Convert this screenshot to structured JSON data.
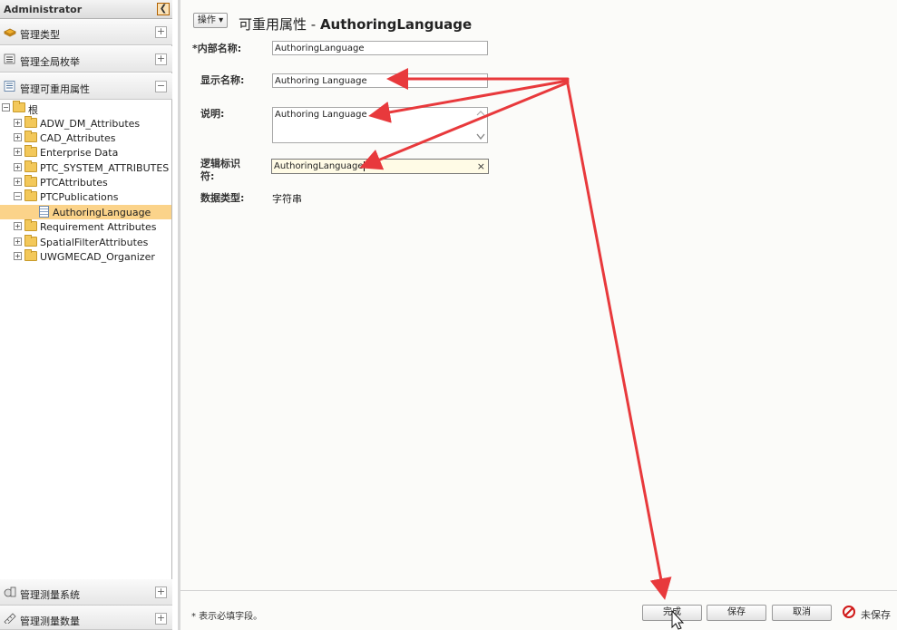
{
  "navigator": {
    "header": "Administrator",
    "collapse_glyph": "❮",
    "sections": [
      {
        "label": "管理类型",
        "icon": "types-icon",
        "toggle": "+"
      },
      {
        "label": "管理全局枚举",
        "icon": "enum-icon",
        "toggle": "+"
      },
      {
        "label": "管理可重用属性",
        "icon": "attributes-icon",
        "toggle": "−"
      }
    ],
    "bottom_sections": [
      {
        "label": "管理测量系统",
        "icon": "measurement-system-icon",
        "toggle": "+"
      },
      {
        "label": "管理测量数量",
        "icon": "measurement-quantity-icon",
        "toggle": "+"
      }
    ]
  },
  "tree": {
    "root": {
      "label": "根",
      "toggle": "−"
    },
    "items": [
      {
        "label": "ADW_DM_Attributes",
        "toggle": "+"
      },
      {
        "label": "CAD_Attributes",
        "toggle": "+"
      },
      {
        "label": "Enterprise Data",
        "toggle": "+"
      },
      {
        "label": "PTC_SYSTEM_ATTRIBUTES",
        "toggle": "+"
      },
      {
        "label": "PTCAttributes",
        "toggle": "+"
      },
      {
        "label": "PTCPublications",
        "toggle": "−"
      },
      {
        "label": "AuthoringLanguage",
        "selected": true
      },
      {
        "label": "Requirement Attributes",
        "toggle": "+"
      },
      {
        "label": "SpatialFilterAttributes",
        "toggle": "+"
      },
      {
        "label": "UWGMECAD_Organizer",
        "toggle": "+"
      }
    ]
  },
  "main": {
    "ops_button": "操作 ▾",
    "title_prefix": "可重用属性 - ",
    "title_name": "AuthoringLanguage",
    "fields": {
      "internal_name_label": "内部名称:",
      "internal_name_required": "*",
      "internal_name_value": "AuthoringLanguage",
      "display_name_label": "显示名称:",
      "display_name_value": "Authoring Language",
      "description_label": "说明:",
      "description_value": "Authoring Language",
      "logical_id_label_1": "逻辑标识",
      "logical_id_label_2": "符:",
      "logical_id_value": "AuthoringLanguage",
      "clear_glyph": "×",
      "data_type_label": "数据类型:",
      "data_type_value": "字符串"
    }
  },
  "footer": {
    "note": "* 表示必填字段。",
    "done": "完成",
    "save": "保存",
    "cancel": "取消",
    "unsaved": "未保存"
  },
  "colors": {
    "annotation_arrow": "#e8393c",
    "selection": "#fbd38a",
    "folder": "#f3c85a",
    "unsaved_icon": "#d01818"
  }
}
